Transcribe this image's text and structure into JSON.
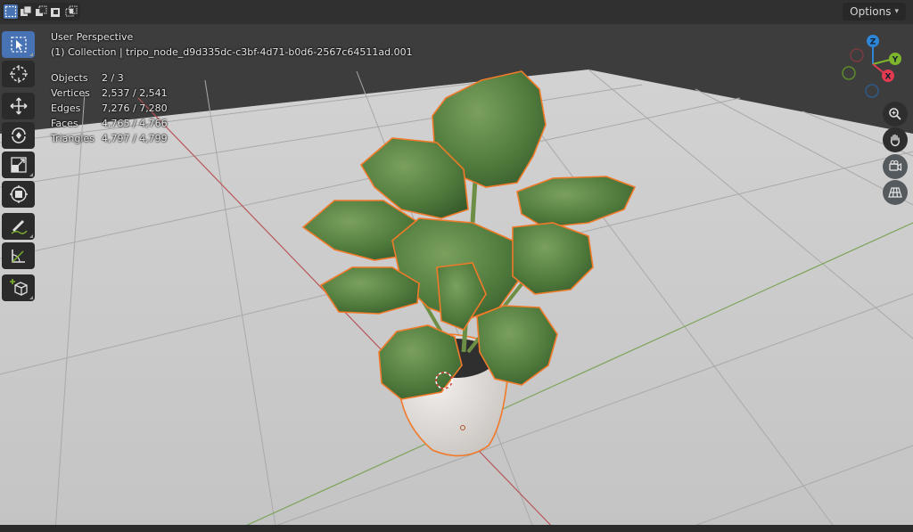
{
  "header": {
    "select_modes": [
      "mode-set-icon",
      "mode-extend-icon",
      "mode-subtract-icon",
      "mode-invert-icon",
      "mode-intersect-icon"
    ],
    "options_label": "Options"
  },
  "toolbar": {
    "tools": [
      "select-box-icon",
      "cursor-icon",
      "move-icon",
      "rotate-icon",
      "scale-icon",
      "transform-icon",
      "annotate-icon",
      "measure-icon",
      "add-cube-icon"
    ]
  },
  "viewport": {
    "view_name": "User Perspective",
    "collection_line": "(1) Collection | tripo_node_d9d335dc-c3bf-4d71-b0d6-2567c64511ad.001",
    "stats": [
      {
        "label": "Objects",
        "value": "2 / 3"
      },
      {
        "label": "Vertices",
        "value": "2,537 / 2,541"
      },
      {
        "label": "Edges",
        "value": "7,276 / 7,280"
      },
      {
        "label": "Faces",
        "value": "4,765 / 4,766"
      },
      {
        "label": "Triangles",
        "value": "4,797 / 4,799"
      }
    ],
    "gizmo": {
      "z_label": "Z",
      "y_label": "Y",
      "x_label": "X"
    },
    "colors": {
      "x_axis": "#e23a4f",
      "y_axis": "#7fb52d",
      "z_axis": "#2e86d6",
      "selection_outline": "#f07a2a"
    }
  },
  "nav_buttons": [
    "zoom-icon",
    "pan-hand-icon",
    "camera-view-icon",
    "ortho-grid-icon"
  ]
}
